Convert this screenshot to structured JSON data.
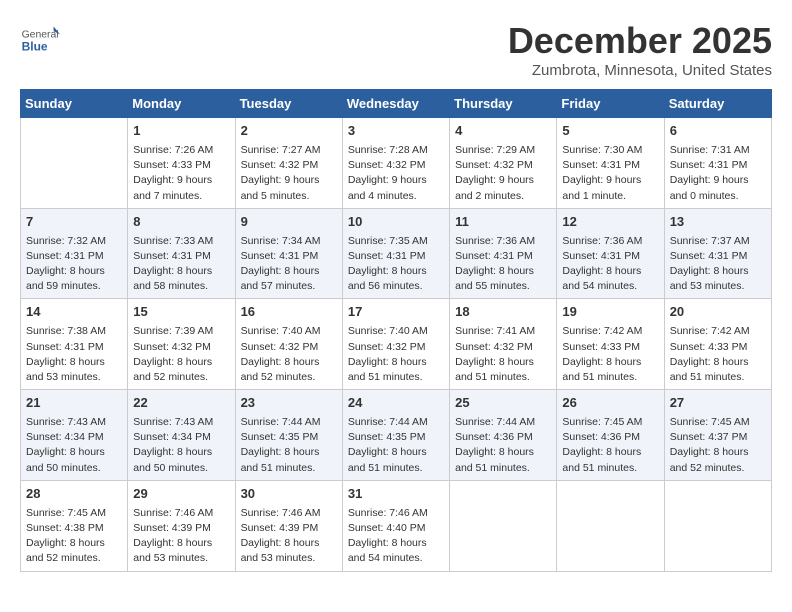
{
  "logo": {
    "general": "General",
    "blue": "Blue"
  },
  "title": {
    "month": "December 2025",
    "location": "Zumbrota, Minnesota, United States"
  },
  "days_of_week": [
    "Sunday",
    "Monday",
    "Tuesday",
    "Wednesday",
    "Thursday",
    "Friday",
    "Saturday"
  ],
  "weeks": [
    [
      {
        "day": "",
        "content": ""
      },
      {
        "day": "1",
        "content": "Sunrise: 7:26 AM\nSunset: 4:33 PM\nDaylight: 9 hours\nand 7 minutes."
      },
      {
        "day": "2",
        "content": "Sunrise: 7:27 AM\nSunset: 4:32 PM\nDaylight: 9 hours\nand 5 minutes."
      },
      {
        "day": "3",
        "content": "Sunrise: 7:28 AM\nSunset: 4:32 PM\nDaylight: 9 hours\nand 4 minutes."
      },
      {
        "day": "4",
        "content": "Sunrise: 7:29 AM\nSunset: 4:32 PM\nDaylight: 9 hours\nand 2 minutes."
      },
      {
        "day": "5",
        "content": "Sunrise: 7:30 AM\nSunset: 4:31 PM\nDaylight: 9 hours\nand 1 minute."
      },
      {
        "day": "6",
        "content": "Sunrise: 7:31 AM\nSunset: 4:31 PM\nDaylight: 9 hours\nand 0 minutes."
      }
    ],
    [
      {
        "day": "7",
        "content": "Sunrise: 7:32 AM\nSunset: 4:31 PM\nDaylight: 8 hours\nand 59 minutes."
      },
      {
        "day": "8",
        "content": "Sunrise: 7:33 AM\nSunset: 4:31 PM\nDaylight: 8 hours\nand 58 minutes."
      },
      {
        "day": "9",
        "content": "Sunrise: 7:34 AM\nSunset: 4:31 PM\nDaylight: 8 hours\nand 57 minutes."
      },
      {
        "day": "10",
        "content": "Sunrise: 7:35 AM\nSunset: 4:31 PM\nDaylight: 8 hours\nand 56 minutes."
      },
      {
        "day": "11",
        "content": "Sunrise: 7:36 AM\nSunset: 4:31 PM\nDaylight: 8 hours\nand 55 minutes."
      },
      {
        "day": "12",
        "content": "Sunrise: 7:36 AM\nSunset: 4:31 PM\nDaylight: 8 hours\nand 54 minutes."
      },
      {
        "day": "13",
        "content": "Sunrise: 7:37 AM\nSunset: 4:31 PM\nDaylight: 8 hours\nand 53 minutes."
      }
    ],
    [
      {
        "day": "14",
        "content": "Sunrise: 7:38 AM\nSunset: 4:31 PM\nDaylight: 8 hours\nand 53 minutes."
      },
      {
        "day": "15",
        "content": "Sunrise: 7:39 AM\nSunset: 4:32 PM\nDaylight: 8 hours\nand 52 minutes."
      },
      {
        "day": "16",
        "content": "Sunrise: 7:40 AM\nSunset: 4:32 PM\nDaylight: 8 hours\nand 52 minutes."
      },
      {
        "day": "17",
        "content": "Sunrise: 7:40 AM\nSunset: 4:32 PM\nDaylight: 8 hours\nand 51 minutes."
      },
      {
        "day": "18",
        "content": "Sunrise: 7:41 AM\nSunset: 4:32 PM\nDaylight: 8 hours\nand 51 minutes."
      },
      {
        "day": "19",
        "content": "Sunrise: 7:42 AM\nSunset: 4:33 PM\nDaylight: 8 hours\nand 51 minutes."
      },
      {
        "day": "20",
        "content": "Sunrise: 7:42 AM\nSunset: 4:33 PM\nDaylight: 8 hours\nand 51 minutes."
      }
    ],
    [
      {
        "day": "21",
        "content": "Sunrise: 7:43 AM\nSunset: 4:34 PM\nDaylight: 8 hours\nand 50 minutes."
      },
      {
        "day": "22",
        "content": "Sunrise: 7:43 AM\nSunset: 4:34 PM\nDaylight: 8 hours\nand 50 minutes."
      },
      {
        "day": "23",
        "content": "Sunrise: 7:44 AM\nSunset: 4:35 PM\nDaylight: 8 hours\nand 51 minutes."
      },
      {
        "day": "24",
        "content": "Sunrise: 7:44 AM\nSunset: 4:35 PM\nDaylight: 8 hours\nand 51 minutes."
      },
      {
        "day": "25",
        "content": "Sunrise: 7:44 AM\nSunset: 4:36 PM\nDaylight: 8 hours\nand 51 minutes."
      },
      {
        "day": "26",
        "content": "Sunrise: 7:45 AM\nSunset: 4:36 PM\nDaylight: 8 hours\nand 51 minutes."
      },
      {
        "day": "27",
        "content": "Sunrise: 7:45 AM\nSunset: 4:37 PM\nDaylight: 8 hours\nand 52 minutes."
      }
    ],
    [
      {
        "day": "28",
        "content": "Sunrise: 7:45 AM\nSunset: 4:38 PM\nDaylight: 8 hours\nand 52 minutes."
      },
      {
        "day": "29",
        "content": "Sunrise: 7:46 AM\nSunset: 4:39 PM\nDaylight: 8 hours\nand 53 minutes."
      },
      {
        "day": "30",
        "content": "Sunrise: 7:46 AM\nSunset: 4:39 PM\nDaylight: 8 hours\nand 53 minutes."
      },
      {
        "day": "31",
        "content": "Sunrise: 7:46 AM\nSunset: 4:40 PM\nDaylight: 8 hours\nand 54 minutes."
      },
      {
        "day": "",
        "content": ""
      },
      {
        "day": "",
        "content": ""
      },
      {
        "day": "",
        "content": ""
      }
    ]
  ]
}
